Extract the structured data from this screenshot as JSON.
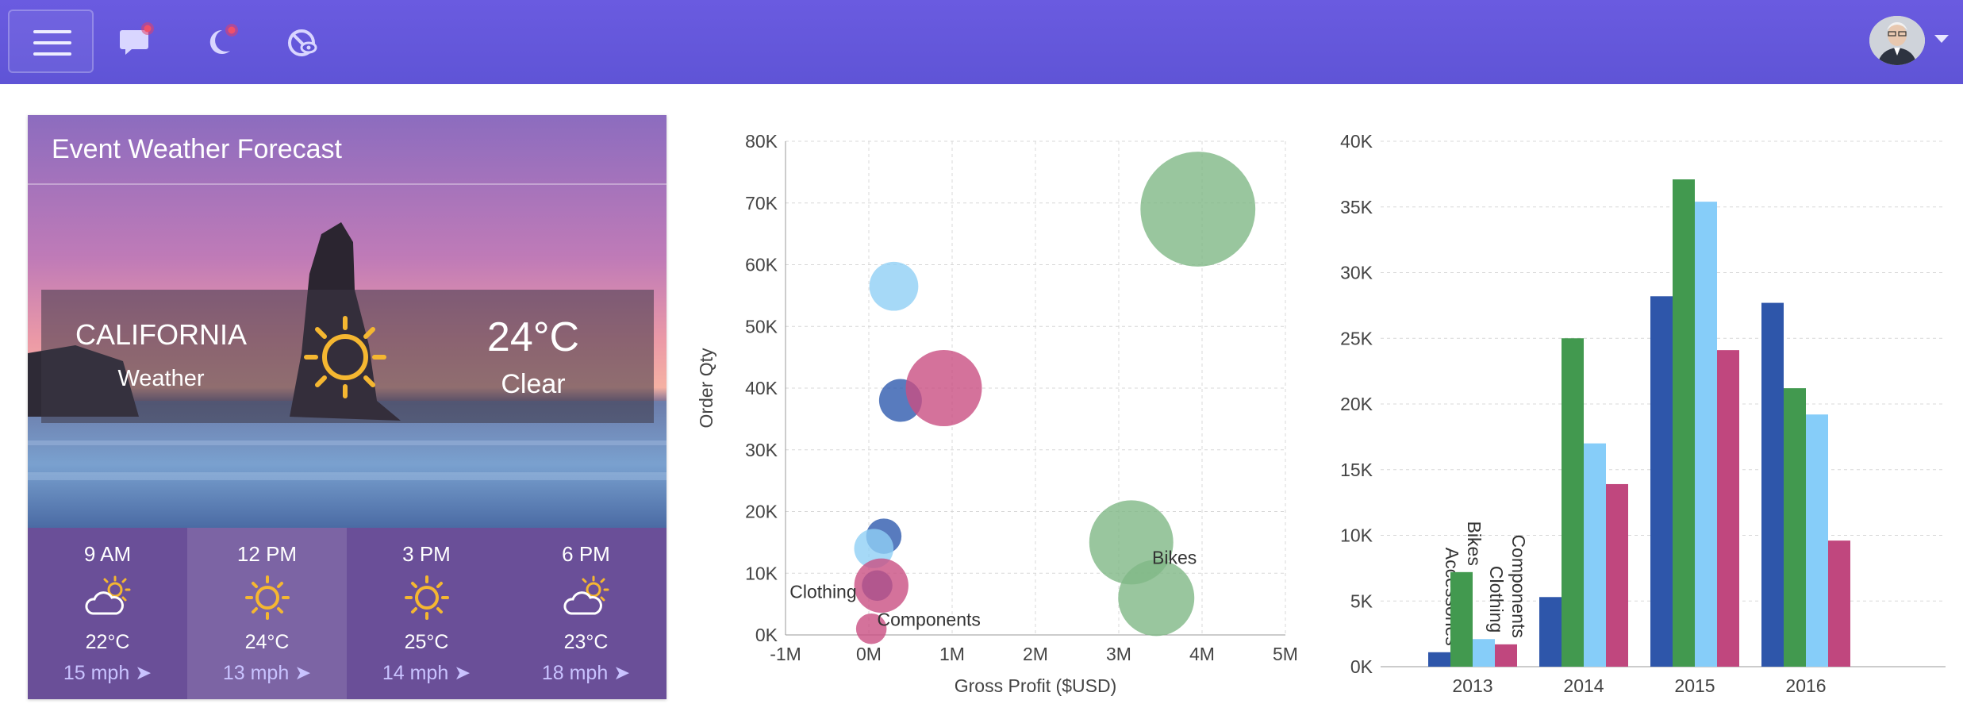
{
  "topbar": {
    "icons": [
      "menu-icon",
      "chat-icon",
      "moon-icon",
      "eye-off-icon"
    ],
    "avatar": "user-avatar",
    "accent": "#6a5be0"
  },
  "weather": {
    "title": "Event Weather Forecast",
    "location": "CALIFORNIA",
    "location_sub": "Weather",
    "temperature": "24°C",
    "condition": "Clear",
    "condition_icon": "sun-icon",
    "forecast": [
      {
        "time": "9 AM",
        "icon": "partly-cloudy-icon",
        "temp": "22°C",
        "wind": "15 mph",
        "wind_icon": "wind-arrow-icon"
      },
      {
        "time": "12 PM",
        "icon": "sun-icon",
        "temp": "24°C",
        "wind": "13 mph",
        "wind_icon": "wind-arrow-icon"
      },
      {
        "time": "3 PM",
        "icon": "sun-icon",
        "temp": "25°C",
        "wind": "14 mph",
        "wind_icon": "wind-arrow-icon"
      },
      {
        "time": "6 PM",
        "icon": "partly-cloudy-icon",
        "temp": "23°C",
        "wind": "18 mph",
        "wind_icon": "wind-arrow-icon"
      }
    ]
  },
  "chart_data": [
    {
      "type": "scatter",
      "xlabel": "Gross Profit ($USD)",
      "ylabel": "Order Qty",
      "xlim": [
        -1000000,
        5000000
      ],
      "ylim": [
        0,
        80000
      ],
      "x_ticks": [
        "-1M",
        "0M",
        "1M",
        "2M",
        "3M",
        "4M",
        "5M"
      ],
      "y_ticks": [
        "0K",
        "10K",
        "20K",
        "30K",
        "40K",
        "50K",
        "60K",
        "70K",
        "80K"
      ],
      "grid": true,
      "series": [
        {
          "name": "Accessories",
          "color": "#2e5aae",
          "points": [
            {
              "x": 380000,
              "y": 38000,
              "size": 1
            },
            {
              "x": 180000,
              "y": 16000,
              "size": 0.6
            },
            {
              "x": 100000,
              "y": 8000,
              "size": 0.4
            }
          ]
        },
        {
          "name": "Bikes",
          "color": "#7fb886",
          "points": [
            {
              "x": 3950000,
              "y": 69000,
              "size": 10
            },
            {
              "x": 3150000,
              "y": 15000,
              "size": 5
            },
            {
              "x": 3450000,
              "y": 6000,
              "size": 4
            }
          ]
        },
        {
          "name": "Clothing",
          "color": "#90d0f5",
          "points": [
            {
              "x": 300000,
              "y": 56500,
              "size": 1.4
            },
            {
              "x": 60000,
              "y": 14000,
              "size": 0.8
            }
          ]
        },
        {
          "name": "Components",
          "color": "#c94f82",
          "points": [
            {
              "x": 900000,
              "y": 40000,
              "size": 4
            },
            {
              "x": 150000,
              "y": 8000,
              "size": 1.8
            },
            {
              "x": 30000,
              "y": 1000,
              "size": 0.4
            }
          ]
        }
      ],
      "annotations": [
        {
          "text": "Bikes",
          "x": 3400000,
          "y": 11500
        },
        {
          "text": "Clothing",
          "x": -950000,
          "y": 6000
        },
        {
          "text": "Components",
          "x": 100000,
          "y": 1500
        }
      ]
    },
    {
      "type": "bar",
      "categories": [
        "2013",
        "2014",
        "2015",
        "2016"
      ],
      "ylim": [
        0,
        40000
      ],
      "y_ticks": [
        "0K",
        "5K",
        "10K",
        "15K",
        "20K",
        "25K",
        "30K",
        "35K",
        "40K"
      ],
      "grid": true,
      "series": [
        {
          "name": "Accessories",
          "color": "#2e56aa",
          "values": [
            1100,
            5300,
            28200,
            27700
          ]
        },
        {
          "name": "Bikes",
          "color": "#42994f",
          "values": [
            7200,
            25000,
            37100,
            21200
          ]
        },
        {
          "name": "Clothing",
          "color": "#86cdf9",
          "values": [
            2100,
            17000,
            35400,
            19200
          ]
        },
        {
          "name": "Components",
          "color": "#c0477e",
          "values": [
            1700,
            13900,
            24100,
            9600
          ]
        }
      ]
    }
  ]
}
